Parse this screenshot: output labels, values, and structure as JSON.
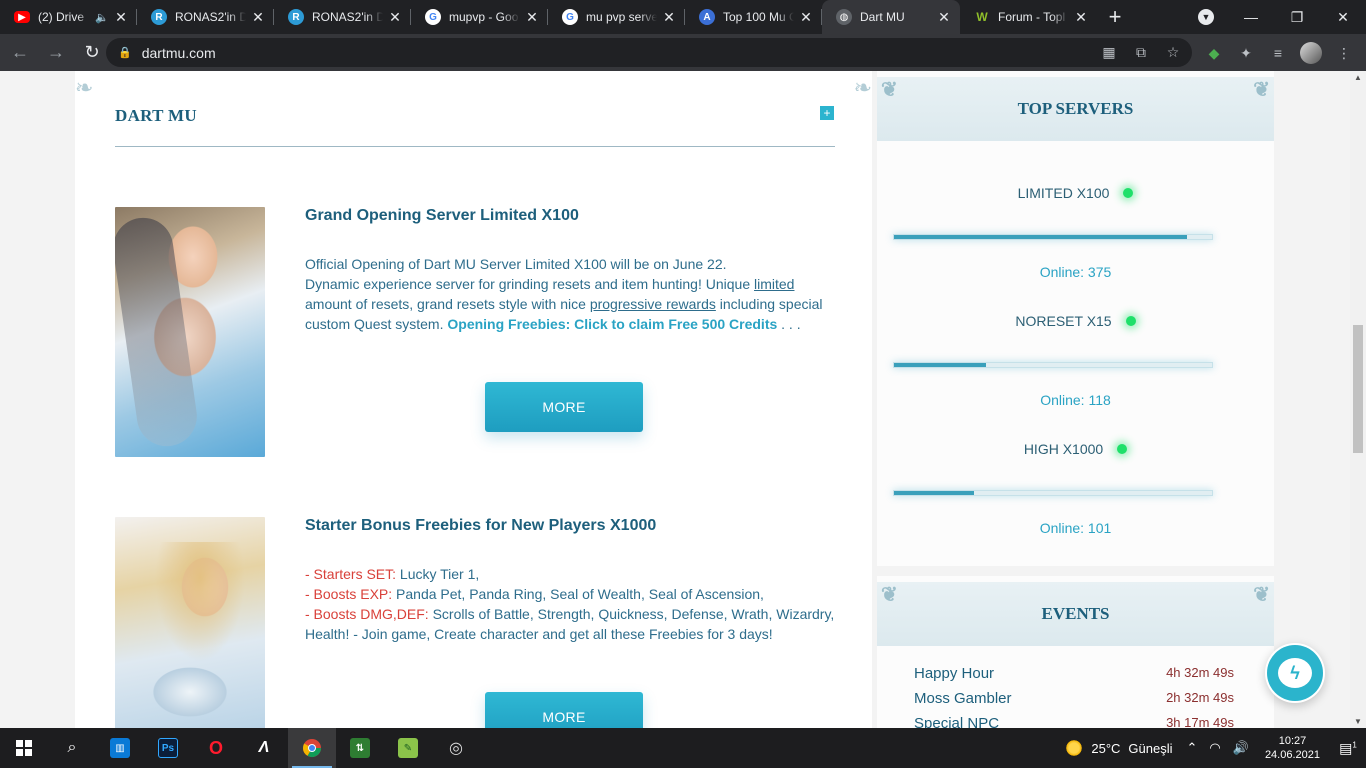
{
  "browser": {
    "tabs": [
      {
        "title": "(2) Drive",
        "icon": "youtube-icon",
        "color": "#ff0000",
        "audio": true,
        "active": false
      },
      {
        "title": "RONAS2'in D",
        "icon": "discord-icon",
        "color": "#2d9bd6",
        "active": false
      },
      {
        "title": "RONAS2'in D",
        "icon": "discord-icon",
        "color": "#2d9bd6",
        "active": false
      },
      {
        "title": "mupvp - Goo",
        "icon": "google-icon",
        "color": "#ffffff",
        "active": false
      },
      {
        "title": "mu pvp serve",
        "icon": "google-icon",
        "color": "#ffffff",
        "active": false
      },
      {
        "title": "Top 100 Mu C",
        "icon": "top100-icon",
        "color": "#3b6fd6",
        "active": false
      },
      {
        "title": "Dart MU",
        "icon": "globe-icon",
        "color": "#5f6368",
        "active": true
      },
      {
        "title": "Forum - Topl",
        "icon": "forum-icon",
        "color": "#8fbf2a",
        "active": false
      }
    ],
    "url": "dartmu.com"
  },
  "news": {
    "heading": "DART MU",
    "posts": [
      {
        "title": "Grand Opening Server Limited X100",
        "line1": "Official Opening of Dart MU Server Limited X100 will be on June 22.",
        "line2_a": "Dynamic experience server for grinding resets and item hunting! Unique ",
        "link1": "limited",
        "line3_a": "amount of resets, grand resets style with nice ",
        "link2": "progressive rewards",
        "line3_b": " including special",
        "line4_a": "custom Quest system. ",
        "cta": "Opening Freebies: Click to claim Free 500 Credits",
        "line4_b": " . . .",
        "more": "MORE"
      },
      {
        "title": "Starter Bonus Freebies for New Players X1000",
        "l1_label": "- Starters SET:",
        "l1_text": " Lucky Tier 1,",
        "l2_label": "- Boosts EXP:",
        "l2_text": " Panda Pet, Panda Ring, Seal of Wealth, Seal of Ascension,",
        "l3_label": "- Boosts DMG,DEF:",
        "l3_text": " Scrolls of Battle, Strength, Quickness, Defense, Wrath, Wizardry,",
        "l4_text": "Health! - Join game, Create character and get all these Freebies for 3 days!",
        "more": "MORE"
      }
    ]
  },
  "top_servers": {
    "heading": "TOP SERVERS",
    "servers": [
      {
        "name": "LIMITED X100",
        "online": "Online: 375",
        "load": 0.92
      },
      {
        "name": "NORESET X15",
        "online": "Online: 118",
        "load": 0.29
      },
      {
        "name": "HIGH X1000",
        "online": "Online: 101",
        "load": 0.25
      }
    ]
  },
  "events": {
    "heading": "EVENTS",
    "items": [
      {
        "name": "Happy Hour",
        "time": "4h 32m 49s"
      },
      {
        "name": "Moss Gambler",
        "time": "2h 32m 49s"
      },
      {
        "name": "Special NPC",
        "time": "3h 17m 49s"
      }
    ]
  },
  "taskbar": {
    "temperature": "25°C",
    "weather": "Güneşli",
    "time": "10:27",
    "date": "24.06.2021",
    "notifications": "1"
  }
}
